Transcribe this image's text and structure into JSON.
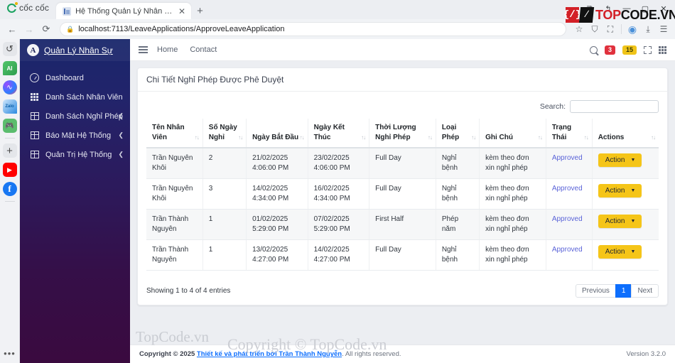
{
  "browser": {
    "brand": "cốc cốc",
    "tab": {
      "title": "Hệ Thống Quản Lý Nhân Sự",
      "close": "✕",
      "favicon": "page-favicon"
    },
    "new_tab": "+",
    "window": {
      "minimize": "—",
      "maximize": "▢",
      "close": "✕",
      "restore": "⧉",
      "back_arrow": "↰"
    },
    "nav": {
      "back": "←",
      "forward": "→",
      "reload": "⟳"
    },
    "address": {
      "lock": "🔒",
      "url": "localhost:7113/LeaveApplications/ApproveLeaveApplication"
    },
    "actions": {
      "star": "☆",
      "shield": "⛉",
      "extensions": "⛶",
      "profile": "◉",
      "downloads": "⤓",
      "menu": "☰"
    }
  },
  "watermark": {
    "logo_left": "{/}",
    "logo_right": "⁄",
    "word_red": "TOP",
    "word_black": "CODE.VN",
    "big1": "TopCode.vn",
    "big2": "Copyright © TopCode.vn"
  },
  "rail": {
    "items": [
      {
        "name": "history-icon",
        "glyph": "↺",
        "cls": "hist"
      },
      {
        "name": "ai-chat-icon",
        "glyph": "AI",
        "cls": "ai"
      },
      {
        "name": "messenger-icon",
        "glyph": "∿",
        "cls": "msg"
      },
      {
        "name": "zalo-icon",
        "glyph": "Zalo",
        "cls": "zalo"
      },
      {
        "name": "game-icon",
        "glyph": "🎮",
        "cls": "game"
      },
      {
        "name": "add-extension-icon",
        "glyph": "+",
        "cls": "plus"
      },
      {
        "name": "youtube-icon",
        "glyph": "▶",
        "cls": "yt"
      },
      {
        "name": "facebook-icon",
        "glyph": "f",
        "cls": "fb"
      }
    ],
    "more": "•••"
  },
  "sidebar": {
    "logo_glyph": "A",
    "title": "Quản Lý Nhân Sự",
    "items": [
      {
        "label": "Dashboard",
        "icon": "gauge",
        "caret": ""
      },
      {
        "label": "Danh Sách Nhân Viên",
        "icon": "grid",
        "caret": ""
      },
      {
        "label": "Danh Sách Nghỉ Phép",
        "icon": "table",
        "caret": "❮"
      },
      {
        "label": "Báo Mật Hệ Thống",
        "icon": "table",
        "caret": "❮"
      },
      {
        "label": "Quản Trị Hệ Thống",
        "icon": "table",
        "caret": "❮"
      }
    ]
  },
  "topbar": {
    "menu_toggle": "hamburger-icon",
    "links": [
      "Home",
      "Contact"
    ],
    "search_icon": "search-icon",
    "badge_red": "3",
    "badge_yellow": "15",
    "fullscreen_icon": "expand-icon",
    "apps_icon": "grid-apps-icon"
  },
  "card": {
    "title": "Chi Tiết Nghỉ Phép Được Phê Duyệt",
    "search": {
      "label": "Search:",
      "value": "",
      "placeholder": ""
    },
    "columns": [
      "Tên Nhân Viên",
      "Số Ngày Nghỉ",
      "Ngày Bắt Đầu",
      "Ngày Kết Thúc",
      "Thời Lượng Nghỉ Phép",
      "Loại Phép",
      "Ghi Chú",
      "Trạng Thái",
      "Actions"
    ],
    "sort_glyph": "↑↓",
    "rows": [
      {
        "employee": "Trần Nguyên Khôi",
        "days": "2",
        "start": "21/02/2025 4:06:00 PM",
        "end": "23/02/2025 4:06:00 PM",
        "duration": "Full Day",
        "type": "Nghỉ bệnh",
        "note": "kèm theo đơn xin nghỉ phép",
        "status": "Approved",
        "action": "Action"
      },
      {
        "employee": "Trần Nguyên Khôi",
        "days": "3",
        "start": "14/02/2025 4:34:00 PM",
        "end": "16/02/2025 4:34:00 PM",
        "duration": "Full Day",
        "type": "Nghỉ bệnh",
        "note": "kèm theo đơn xin nghỉ phép",
        "status": "Approved",
        "action": "Action"
      },
      {
        "employee": "Trần Thành Nguyên",
        "days": "1",
        "start": "01/02/2025 5:29:00 PM",
        "end": "07/02/2025 5:29:00 PM",
        "duration": "First Half",
        "type": "Phép năm",
        "note": "kèm theo đơn xin nghỉ phép",
        "status": "Approved",
        "action": "Action"
      },
      {
        "employee": "Trần Thành Nguyên",
        "days": "1",
        "start": "13/02/2025 4:27:00 PM",
        "end": "14/02/2025 4:27:00 PM",
        "duration": "Full Day",
        "type": "Nghỉ bệnh",
        "note": "kèm theo đơn xin nghỉ phép",
        "status": "Approved",
        "action": "Action"
      }
    ],
    "footer": {
      "showing": "Showing 1 to 4 of 4 entries",
      "previous": "Previous",
      "page": "1",
      "next": "Next"
    }
  },
  "app_footer": {
    "copyright_prefix": "Copyright © 2025 ",
    "link": "Thiết kế và phát triển bởi Trần Thành Nguyễn",
    "copyright_suffix": ". All rights reserved.",
    "version_label": "Version ",
    "version_value": "3.2.0"
  },
  "colors": {
    "accent_blue": "#0d6efd",
    "action_yellow": "#f5c518",
    "badge_red": "#e0313d",
    "badge_yellow": "#f0c419",
    "status_link": "#5a63d8",
    "sidebar_top": "#19266b",
    "sidebar_bottom": "#3a0a3f"
  }
}
